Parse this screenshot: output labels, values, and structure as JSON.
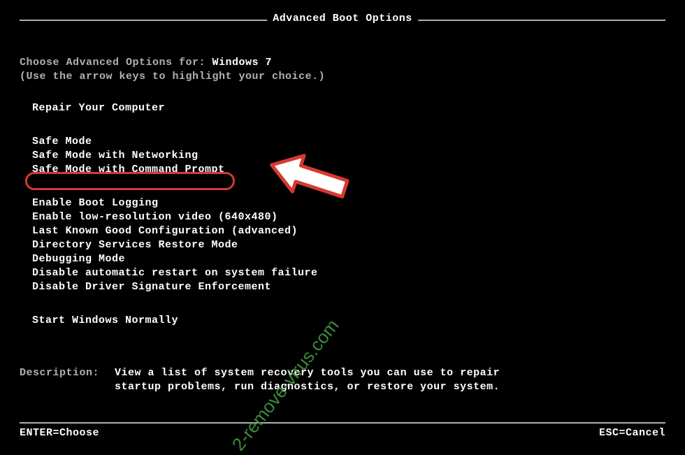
{
  "title": "Advanced Boot Options",
  "instruction_prefix": "Choose Advanced Options for: ",
  "os_name": "Windows 7",
  "instruction_sub": "(Use the arrow keys to highlight your choice.)",
  "groups": [
    {
      "items": [
        "Repair Your Computer"
      ]
    },
    {
      "items": [
        "Safe Mode",
        "Safe Mode with Networking",
        "Safe Mode with Command Prompt"
      ]
    },
    {
      "items": [
        "Enable Boot Logging",
        "Enable low-resolution video (640x480)",
        "Last Known Good Configuration (advanced)",
        "Directory Services Restore Mode",
        "Debugging Mode",
        "Disable automatic restart on system failure",
        "Disable Driver Signature Enforcement"
      ]
    },
    {
      "items": [
        "Start Windows Normally"
      ]
    }
  ],
  "highlighted_item": "Safe Mode with Command Prompt",
  "description_label": "Description:",
  "description_text": "View a list of system recovery tools you can use to repair startup problems, run diagnostics, or restore your system.",
  "footer_left": "ENTER=Choose",
  "footer_right": "ESC=Cancel",
  "watermark": "2-remove-virus.com",
  "annotation_color": "#d63a2f"
}
